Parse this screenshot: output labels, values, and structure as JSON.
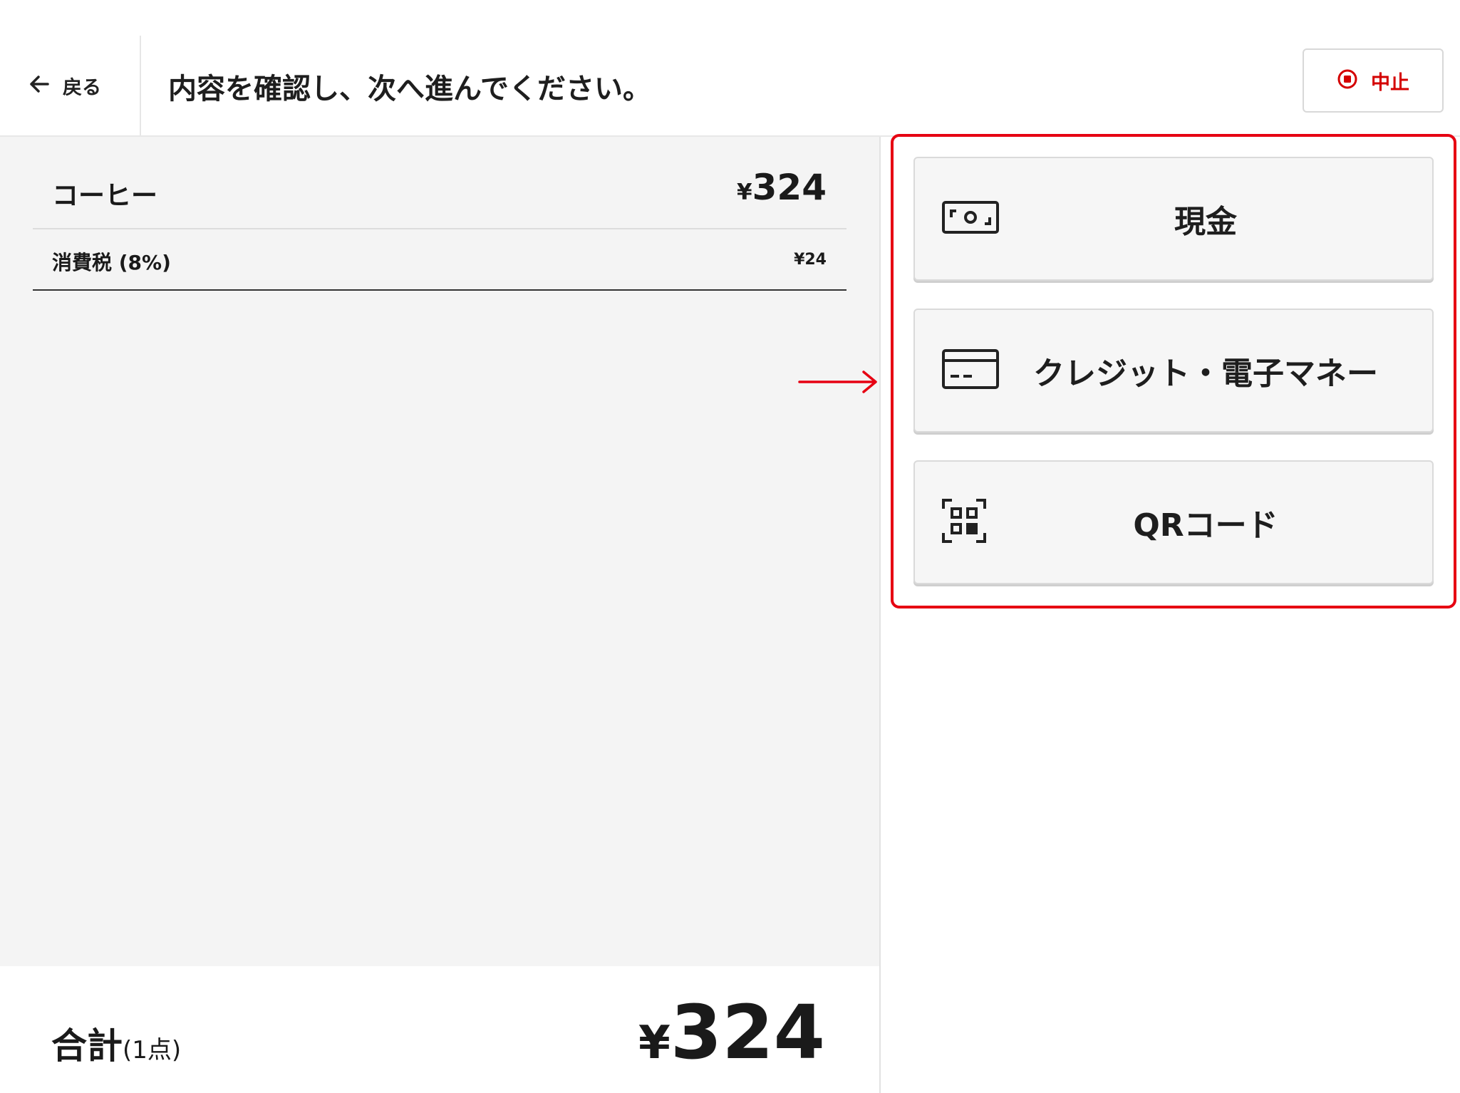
{
  "header": {
    "back_label": "戻る",
    "title": "内容を確認し、次へ進んでください。",
    "cancel_label": "中止"
  },
  "order": {
    "items": [
      {
        "name": "コーヒー",
        "price_symbol": "¥",
        "price": "324"
      }
    ],
    "tax": {
      "label": "消費税 (8%)",
      "amount": "¥24"
    },
    "total": {
      "label": "合計",
      "count": "(1点)",
      "price_symbol": "¥",
      "price": "324"
    }
  },
  "payment_methods": [
    {
      "label": "現金",
      "icon": "cash-icon"
    },
    {
      "label": "クレジット・電子マネー",
      "icon": "credit-card-icon"
    },
    {
      "label": "QRコード",
      "icon": "qr-code-icon"
    }
  ],
  "colors": {
    "accent_red": "#e60012",
    "cancel_red": "#d40000",
    "panel_bg": "#f4f4f4",
    "button_bg": "#f6f6f6",
    "text": "#1a1a1a"
  }
}
